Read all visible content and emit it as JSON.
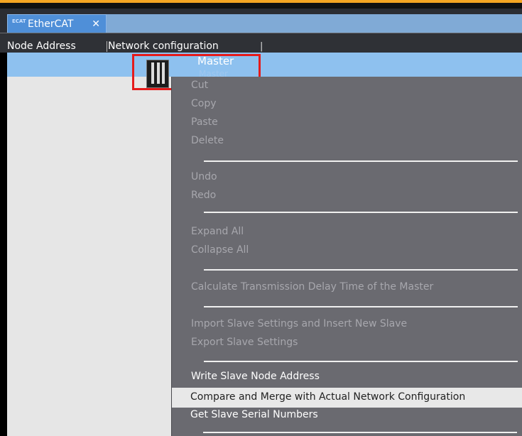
{
  "tab": {
    "title": "EtherCAT",
    "icon_text": "ECAT",
    "close": "✕"
  },
  "header": {
    "node_address": "Node Address",
    "network_configuration": "Network configuration",
    "separator": "|"
  },
  "tree": {
    "master_label": "Master",
    "master_sub": "Master"
  },
  "menu": {
    "cut": "Cut",
    "copy": "Copy",
    "paste": "Paste",
    "delete": "Delete",
    "undo": "Undo",
    "redo": "Redo",
    "expand_all": "Expand All",
    "collapse_all": "Collapse All",
    "calc_delay": "Calculate Transmission Delay Time of the Master",
    "import_slave": "Import Slave Settings and Insert New Slave",
    "export_slave": "Export Slave Settings",
    "write_node": "Write Slave Node Address",
    "compare_merge": "Compare and Merge with Actual Network Configuration",
    "get_serial": "Get Slave Serial Numbers"
  },
  "colors": {
    "accent": "#f5a623",
    "tab": "#4f8fd8",
    "selection": "#8ec1ef",
    "highlight_box": "#e51b1b",
    "menu_bg": "#6a6a70"
  }
}
